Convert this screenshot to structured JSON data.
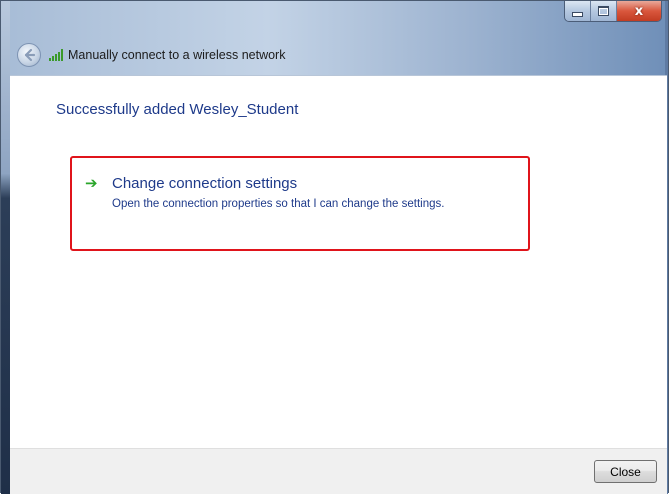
{
  "window": {
    "title": "Manually connect to a wireless network",
    "close_glyph": "x"
  },
  "content": {
    "heading": "Successfully added Wesley_Student",
    "task": {
      "title": "Change connection settings",
      "description": "Open the connection properties so that I can change the settings.",
      "arrow": "➔"
    }
  },
  "footer": {
    "close_label": "Close"
  },
  "icons": {
    "back": "back-arrow-icon",
    "signal": "wireless-signal-icon",
    "task": "green-arrow-icon"
  },
  "colors": {
    "link": "#1e3a8a",
    "highlight_border": "#e0141b",
    "arrow": "#2aa52a"
  }
}
